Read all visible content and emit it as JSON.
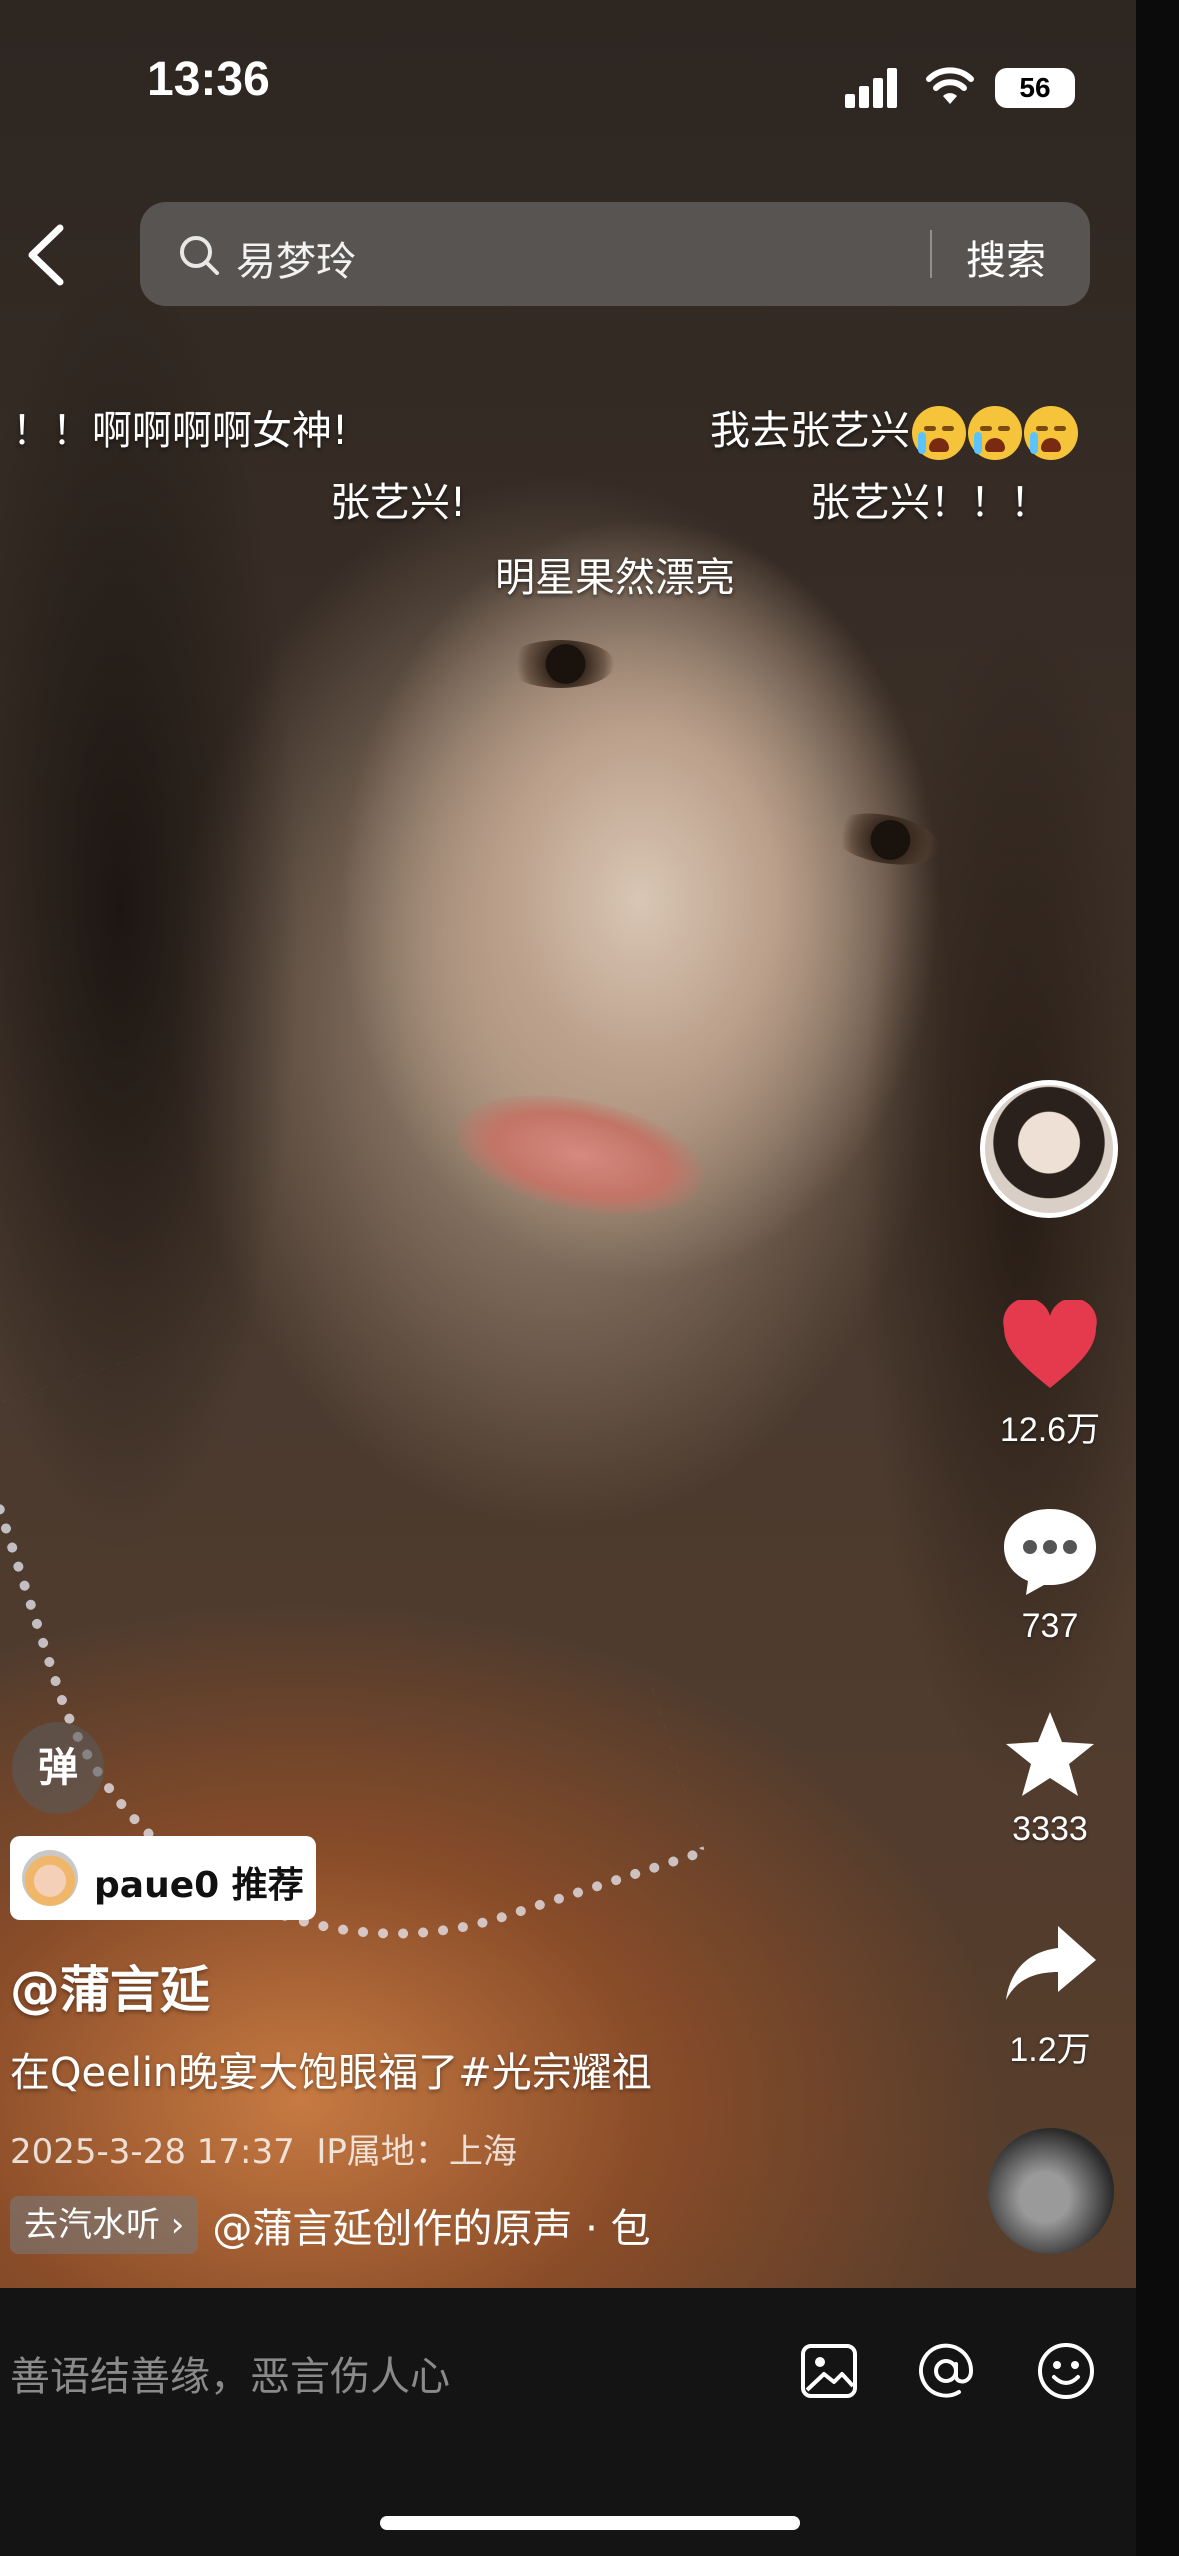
{
  "status_bar": {
    "time": "13:36",
    "battery": "56"
  },
  "search": {
    "query": "易梦玲",
    "button": "搜索"
  },
  "danmu": [
    {
      "text": "！！啊啊啊啊女神!"
    },
    {
      "text": "我去张艺兴"
    },
    {
      "text": "张艺兴!"
    },
    {
      "text": "张艺兴！！！"
    },
    {
      "text": "明星果然漂亮"
    }
  ],
  "rail": {
    "likes": "12.6万",
    "comments": "737",
    "favorites": "3333",
    "shares": "1.2万"
  },
  "danmu_toggle": "弹",
  "recommend": {
    "user": "paue0",
    "label": "推荐"
  },
  "post": {
    "author": "@蒲言延",
    "caption": "在Qeelin晚宴大饱眼福了#光宗耀祖",
    "date": "2025-3-28 17:37",
    "ip": "IP属地：上海"
  },
  "music": {
    "chip": "去汽水听 ›",
    "text": "@蒲言延创作的原声 · 包"
  },
  "comment_bar": {
    "placeholder": "善语结善缘，恶言伤人心"
  },
  "colors": {
    "like": "#e5394d",
    "background": "#141414"
  }
}
